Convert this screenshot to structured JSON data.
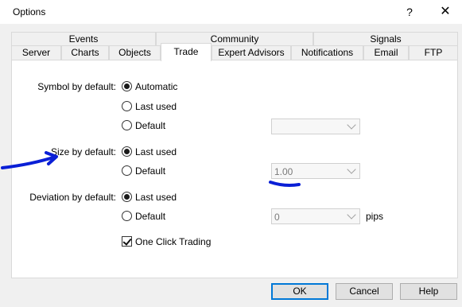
{
  "window": {
    "title": "Options",
    "help_glyph": "?",
    "close_glyph": "✕"
  },
  "tabs": {
    "row_top": [
      "Events",
      "Community",
      "Signals"
    ],
    "row_bottom": [
      "Server",
      "Charts",
      "Objects",
      "Trade",
      "Expert Advisors",
      "Notifications",
      "Email",
      "FTP"
    ],
    "active": "Trade"
  },
  "trade": {
    "symbol": {
      "label": "Symbol by default:",
      "options": [
        "Automatic",
        "Last used",
        "Default"
      ],
      "selected": "Automatic",
      "combo_value": ""
    },
    "size": {
      "label": "Size by default:",
      "options": [
        "Last used",
        "Default"
      ],
      "selected": "Last used",
      "combo_value": "1.00"
    },
    "deviation": {
      "label": "Deviation by default:",
      "options": [
        "Last used",
        "Default"
      ],
      "selected": "Last used",
      "combo_value": "0",
      "unit": "pips"
    },
    "one_click": {
      "label": "One Click Trading",
      "checked": true
    }
  },
  "buttons": {
    "ok": "OK",
    "cancel": "Cancel",
    "help": "Help"
  },
  "colors": {
    "annotation": "#0a1fd6",
    "accent": "#0078d7"
  }
}
